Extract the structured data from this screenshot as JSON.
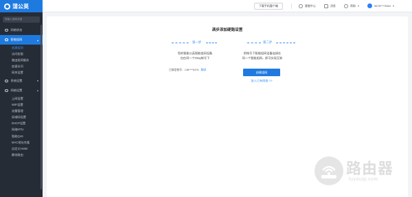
{
  "app": {
    "brand": "蒲公英"
  },
  "sidebar": {
    "search_placeholder": "搜输入搜索关键",
    "sections": [
      {
        "label": "网络状态"
      },
      {
        "label": "智能组网",
        "active": true,
        "items": [
          "创建组网",
          "访问权限",
          "路由组网服务",
          "加速访问",
          "网关设置"
        ]
      },
      {
        "label": "系统设置"
      },
      {
        "label": "网络设置",
        "items": [
          "上网设置",
          "WiFi设置",
          "流量管理",
          "局域网设置",
          "DHCP设置",
          "网络MTU",
          "智能QoS",
          "MAC地址克隆",
          "自定义Hosts",
          "静态路由"
        ]
      }
    ]
  },
  "topbar": {
    "download_label": "下载手机客户端",
    "service_label": "客服中心",
    "notice_label": "消息",
    "help_label": "帮助",
    "account_label": "5678****3364"
  },
  "main": {
    "title": "满步添加硬路设置",
    "step1": {
      "label": "第一步",
      "desc_line1": "您的智能公英智能组网设备",
      "desc_line2": "也在同一个Oray帐号下",
      "bound_text": "已绑定帐号：138****5376",
      "unbind_label": "解绑"
    },
    "step2": {
      "label": "第二步",
      "desc_line1": "把帐号下智能组网设备连接在",
      "desc_line2": "同一个智能组网，即可实现互联",
      "button_label": "创建组网",
      "join_link": "加入已有网络 >>"
    }
  },
  "watermark": {
    "title": "路由器",
    "sub": "luyouqi.com"
  },
  "colors": {
    "accent": "#1f7ae0",
    "sidebar_bg": "#262c35"
  }
}
